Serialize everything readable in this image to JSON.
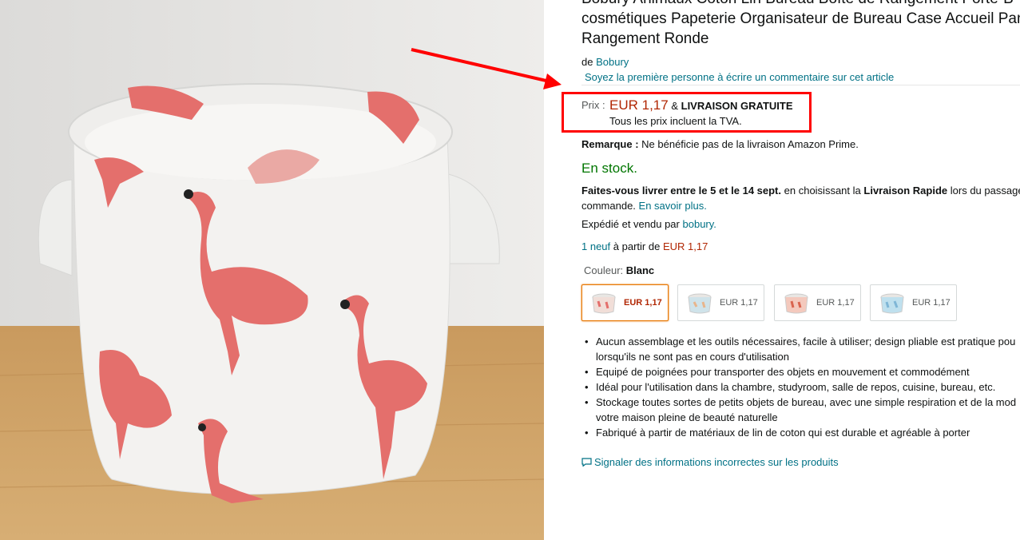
{
  "product": {
    "title_lines": [
      "Bobury Animaux Coton Lin Bureau Boîte de Rangement Porte-B",
      "cosmétiques Papeterie Organisateur de Bureau Case Accueil Pan",
      "Rangement Ronde"
    ],
    "byline_prefix": "de",
    "brand": "Bobury",
    "review_link": "Soyez la première personne à écrire un commentaire sur cet article"
  },
  "price": {
    "label": "Prix :",
    "amount": "EUR 1,17",
    "amp": "&",
    "free_delivery": "LIVRAISON GRATUITE",
    "vat_note": "Tous les prix incluent la TVA."
  },
  "remark": {
    "label": "Remarque :",
    "text": "Ne bénéficie pas de la livraison Amazon Prime."
  },
  "stock": "En stock.",
  "delivery": {
    "bold1": "Faites-vous livrer entre le 5 et le 14 sept.",
    "text1": "en choisissant la",
    "bold2": "Livraison Rapide",
    "text2": "lors du passage",
    "line2": "commande.",
    "learn_more": "En savoir plus."
  },
  "shipping": {
    "text": "Expédié et vendu par",
    "seller": "bobury."
  },
  "offers": {
    "count_link": "1 neuf",
    "text": "à partir de",
    "price": "EUR 1,17"
  },
  "color": {
    "label": "Couleur:",
    "selected": "Blanc",
    "options": [
      {
        "price": "EUR 1,17",
        "color": "#f1ded8"
      },
      {
        "price": "EUR 1,17",
        "color": "#cfe3ea"
      },
      {
        "price": "EUR 1,17",
        "color": "#f4c9bd"
      },
      {
        "price": "EUR 1,17",
        "color": "#bfe0ee"
      }
    ]
  },
  "bullets": [
    "Aucun assemblage et les outils nécessaires, facile à utiliser; design pliable est pratique pou",
    "lorsqu'ils ne sont pas en cours d'utilisation",
    "Equipé de poignées pour transporter des objets en mouvement et commodément",
    "Idéal pour l'utilisation dans la chambre, studyroom, salle de repos, cuisine, bureau, etc.",
    "Stockage toutes sortes de petits objets de bureau, avec une simple respiration et de la mod",
    "votre maison pleine de beauté naturelle",
    "Fabriqué à partir de matériaux de lin de coton qui est durable et agréable à porter"
  ],
  "report_link": "Signaler des informations incorrectes sur les produits",
  "colors": {
    "price_red": "#b12704",
    "link": "#007185",
    "stock_green": "#007600",
    "annotation_red": "#ff0000",
    "flamingo": "#e46f6c"
  }
}
